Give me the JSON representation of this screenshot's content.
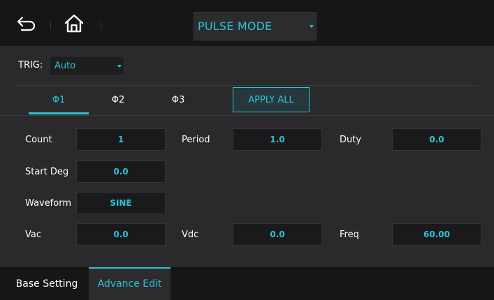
{
  "header": {
    "back_icon": "back-arrow-icon",
    "home_icon": "home-icon",
    "mode_select": "PULSE MODE"
  },
  "trig": {
    "label": "TRIG:",
    "value": "Auto"
  },
  "tabs": [
    {
      "label": "Φ1",
      "active": true
    },
    {
      "label": "Φ2",
      "active": false
    },
    {
      "label": "Φ3",
      "active": false
    }
  ],
  "apply_all": "APPLY ALL",
  "fields": {
    "count": {
      "label": "Count",
      "value": "1"
    },
    "period": {
      "label": "Period",
      "value": "1.0"
    },
    "duty": {
      "label": "Duty",
      "value": "0.0"
    },
    "start_deg": {
      "label": "Start Deg",
      "value": "0.0"
    },
    "waveform": {
      "label": "Waveform",
      "value": "SINE"
    },
    "vac": {
      "label": "Vac",
      "value": "0.0"
    },
    "vdc": {
      "label": "Vdc",
      "value": "0.0"
    },
    "freq": {
      "label": "Freq",
      "value": "60.00"
    }
  },
  "bottom_tabs": [
    {
      "label": "Base Setting",
      "active": false
    },
    {
      "label": "Advance Edit",
      "active": true
    }
  ],
  "colors": {
    "accent": "#2ec3d6",
    "background": "#2a2a2d",
    "bar": "#161617",
    "field": "#1a1a1c"
  }
}
